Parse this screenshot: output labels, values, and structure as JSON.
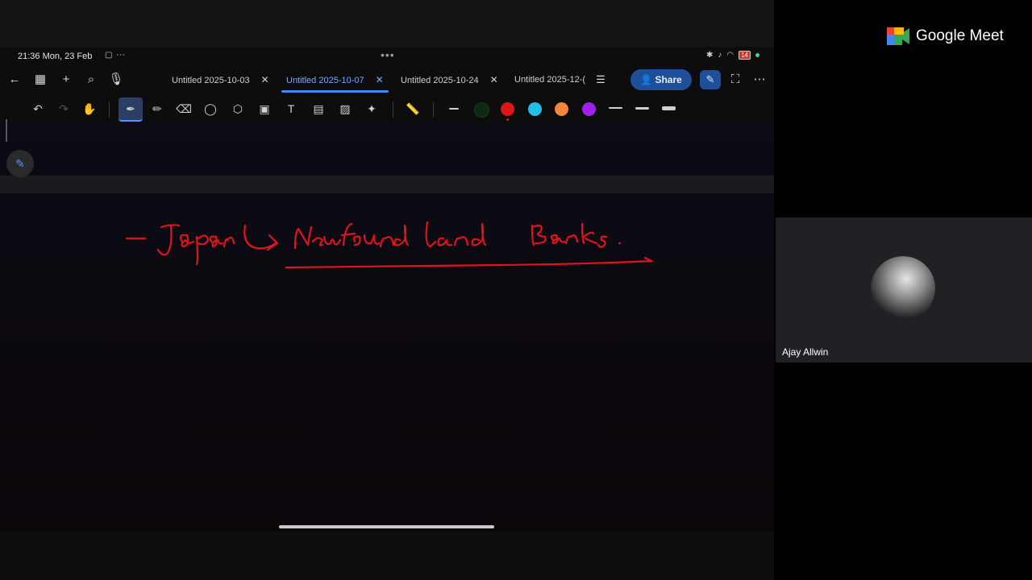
{
  "status_bar": {
    "time_date": "21:36  Mon, 23 Feb",
    "more": "···",
    "battery": "14"
  },
  "nav": {
    "icons": [
      "back-arrow-icon",
      "grid-icon",
      "plus-icon",
      "search-icon",
      "mic-icon"
    ],
    "tabs": [
      {
        "label": "Untitled 2025-10-03",
        "active": false
      },
      {
        "label": "Untitled 2025-10-07",
        "active": true
      },
      {
        "label": "Untitled 2025-10-24",
        "active": false
      },
      {
        "label": "Untitled 2025-12-(",
        "active": false
      }
    ],
    "share_label": "Share"
  },
  "toolbar": {
    "colors": [
      "#0f2a12",
      "#e01515",
      "#1ec0e8",
      "#f2873a",
      "#a020f0"
    ],
    "selected_tool": "pen"
  },
  "meet": {
    "brand": "Google Meet",
    "participant_name": "Ajay Allwin"
  }
}
